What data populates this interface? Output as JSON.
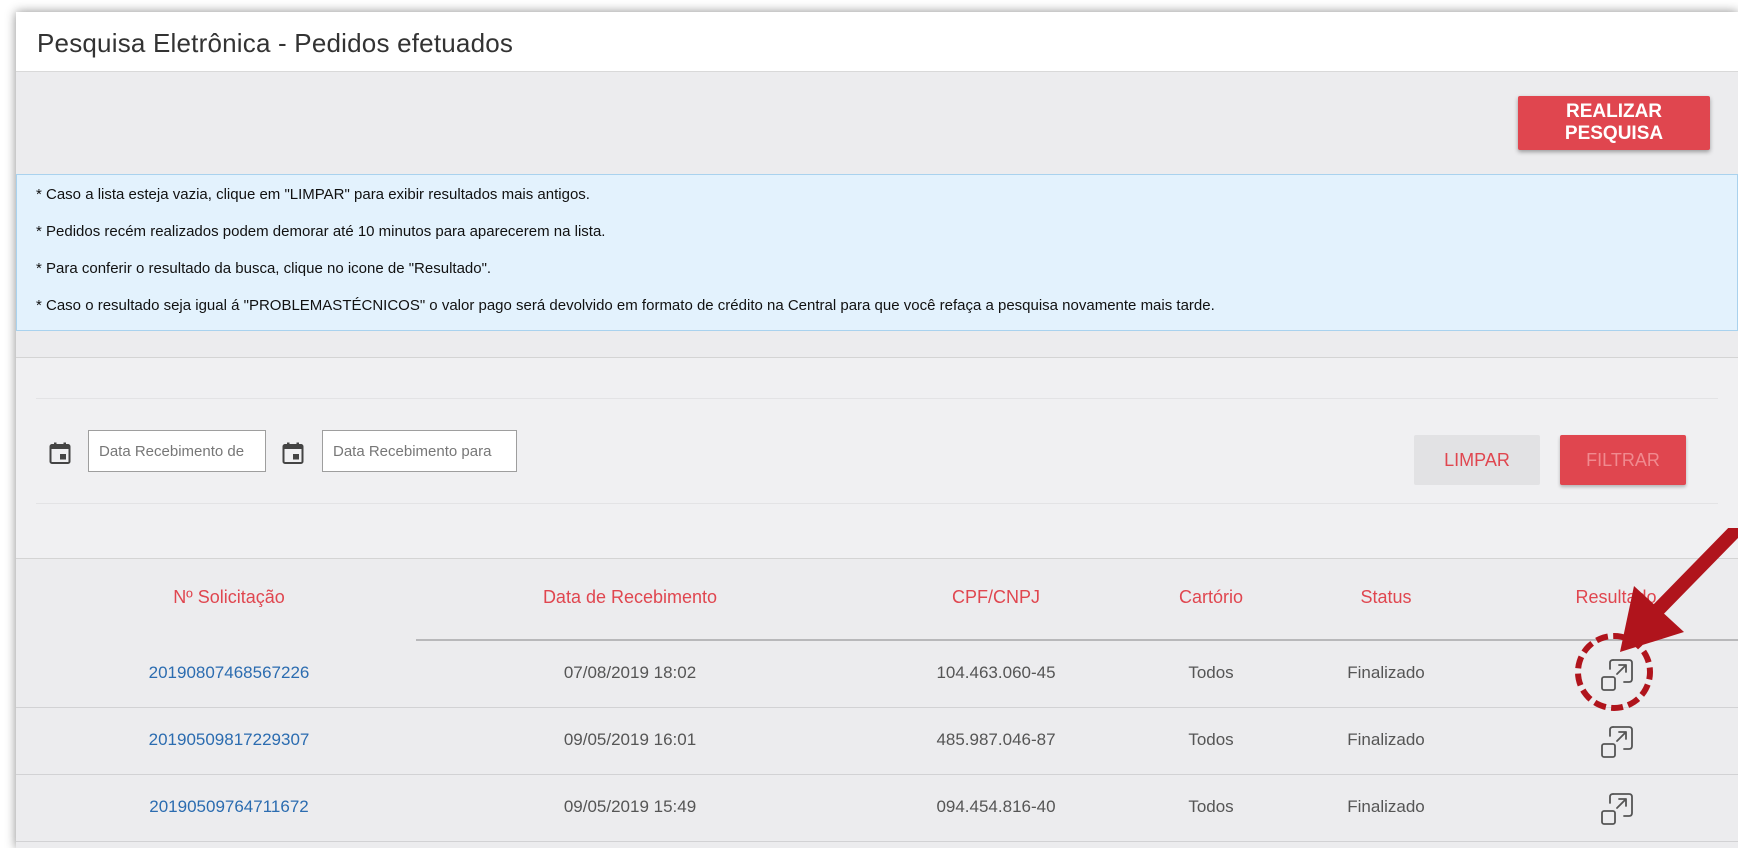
{
  "page": {
    "title": "Pesquisa Eletrônica -  Pedidos efetuados",
    "search_button": "REALIZAR PESQUISA"
  },
  "info": {
    "lines": [
      "* Caso a lista esteja vazia, clique em \"LIMPAR\" para exibir resultados mais antigos.",
      "* Pedidos recém realizados podem demorar até 10 minutos para aparecerem na lista.",
      "* Para conferir o resultado da busca, clique no icone de \"Resultado\".",
      "* Caso o resultado seja igual á \"PROBLEMASTÉCNICOS\" o valor pago será devolvido em formato de crédito na Central para que você refaça a pesquisa novamente mais tarde."
    ]
  },
  "filters": {
    "date_from_placeholder": "Data Recebimento de",
    "date_to_placeholder": "Data Recebimento para",
    "clear_label": "LIMPAR",
    "filter_label": "FILTRAR",
    "calendar_icon": "calendar-icon"
  },
  "table": {
    "headers": [
      "Nº Solicitação",
      "Data de Recebimento",
      "CPF/CNPJ",
      "Cartório",
      "Status",
      "Resultado"
    ],
    "rows": [
      {
        "id": "20190807468567226",
        "date": "07/08/2019 18:02",
        "doc": "104.463.060-45",
        "cartorio": "Todos",
        "status": "Finalizado"
      },
      {
        "id": "20190509817229307",
        "date": "09/05/2019 16:01",
        "doc": "485.987.046-87",
        "cartorio": "Todos",
        "status": "Finalizado"
      },
      {
        "id": "20190509764711672",
        "date": "09/05/2019 15:49",
        "doc": "094.454.816-40",
        "cartorio": "Todos",
        "status": "Finalizado"
      }
    ],
    "result_icon": "open-in-new-icon"
  },
  "annotation": {
    "highlight_color": "#b0141c",
    "arrow_color": "#b0141c"
  },
  "colors": {
    "accent": "#e0464f",
    "link": "#2b6cb0",
    "info_bg": "#e3f2fd"
  }
}
